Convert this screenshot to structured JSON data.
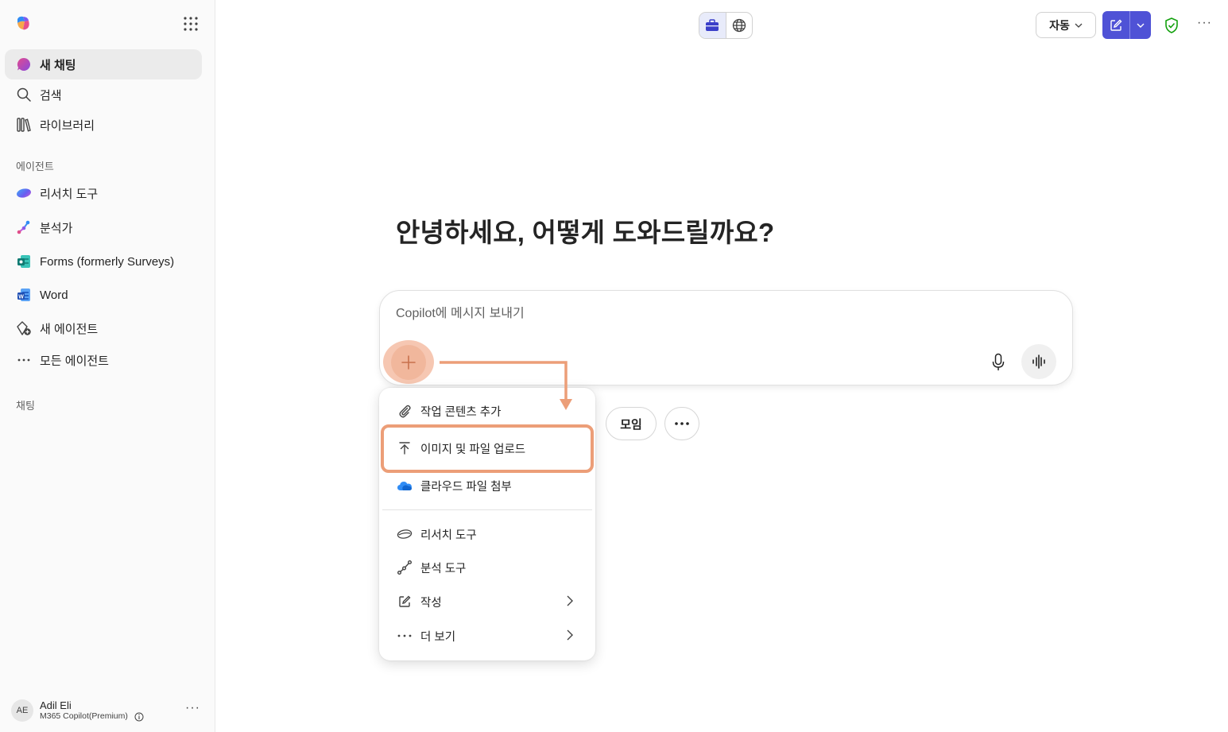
{
  "sidebar": {
    "nav": {
      "new_chat": "새 채팅",
      "search": "검색",
      "library": "라이브러리"
    },
    "agents_label": "에이전트",
    "agents": {
      "researcher": "리서치 도구",
      "analyst": "분석가",
      "forms": "Forms (formerly Surveys)",
      "word": "Word",
      "new_agent": "새 에이전트",
      "all_agents": "모든 에이전트"
    },
    "chats_label": "채팅",
    "user": {
      "initials": "AE",
      "name": "Adil Eli",
      "plan": "M365 Copilot(Premium)"
    }
  },
  "topbar": {
    "mode_label": "자동",
    "accent_color": "#4f52d6"
  },
  "main": {
    "greeting": "안녕하세요, 어떻게 도와드릴까요?",
    "composer": {
      "placeholder": "Copilot에 메시지 보내기"
    },
    "chips": {
      "meeting": "모임",
      "more": "···"
    }
  },
  "menu": {
    "add_work_content": "작업 콘텐츠 추가",
    "upload_images_files": "이미지 및 파일 업로드",
    "attach_cloud_files": "클라우드 파일 첨부",
    "researcher": "리서치 도구",
    "analyst": "분석 도구",
    "write": "작성",
    "see_more": "더 보기"
  },
  "annotation": {
    "highlight_color": "#ec9e78"
  }
}
